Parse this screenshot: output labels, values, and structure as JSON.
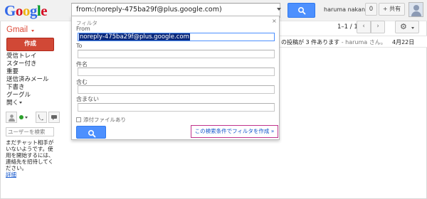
{
  "brand": {
    "logo_letters": [
      "G",
      "o",
      "o",
      "g",
      "l",
      "e"
    ],
    "logo_colors": [
      "#3369e8",
      "#d50f25",
      "#eeb211",
      "#3369e8",
      "#009925",
      "#d50f25"
    ],
    "product_label": "Gmail"
  },
  "header": {
    "search_value": "from:(noreply-475ba29f@plus.google.com)",
    "user_name": "haruma nakano",
    "notification_count": "0",
    "share_label": "+ 共有"
  },
  "sidebar": {
    "compose_label": "作成",
    "items": [
      {
        "label": "受信トレイ"
      },
      {
        "label": "スター付き"
      },
      {
        "label": "重要"
      },
      {
        "label": "送信済みメール"
      },
      {
        "label": "下書き"
      },
      {
        "label": "グーグル"
      },
      {
        "label": "開く"
      }
    ]
  },
  "chat": {
    "search_placeholder": "ユーザーを検索",
    "help_text": "まだチャット相手がいないようです。使用を開始するには、連絡先を招待してください。",
    "more_link": "詳細"
  },
  "toolbar": {
    "pagination": "1–1 / 1",
    "prev_glyph": "‹",
    "next_glyph": "›",
    "settings_glyph": "⚙"
  },
  "mail_row": {
    "snippet": "の投稿が 3 件あります",
    "sender_suffix": " - haruma さん。",
    "date": "4月22日"
  },
  "filter": {
    "title": "フィルタ",
    "close_glyph": "×",
    "from_label": "From",
    "from_value": "noreply-475ba29f@plus.google.com",
    "to_label": "To",
    "subject_label": "件名",
    "has_words_label": "含む",
    "excludes_label": "含まない",
    "attachment_label": "添付ファイルあり",
    "create_filter_link": "この検索条件でフィルタを作成 »"
  },
  "colors": {
    "accent_blue": "#4d90fe",
    "compose_red": "#d14836",
    "gmail_red": "#dd4b39",
    "link_blue": "#1155cc",
    "highlight_magenta": "#c0338c"
  }
}
